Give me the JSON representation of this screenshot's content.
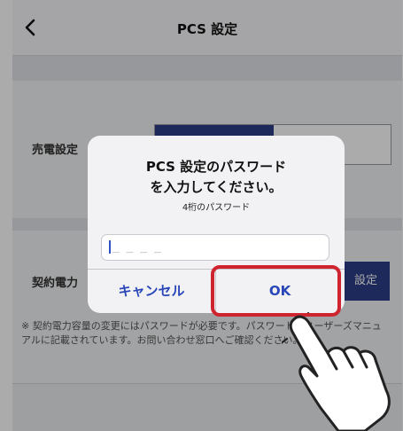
{
  "navbar": {
    "title": "PCS 設定",
    "back_icon": "chevron-left-icon"
  },
  "settings": {
    "sell_label": "売電設定",
    "contract_label": "契約電力",
    "contract_button": "設定",
    "note": "※ 契約電力容量の変更にはパスワードが必要です。パスワードはユーザーズマニュアルに記載されています。お問い合わせ窓口へご確認ください。"
  },
  "dialog": {
    "title_line1": "PCS 設定のパスワード",
    "title_line2": "を入力してください。",
    "subtitle": "4桁のパスワード",
    "input_placeholder": "_ _ _ _",
    "cancel_label": "キャンセル",
    "ok_label": "OK"
  },
  "colors": {
    "accent": "#2a3e86",
    "dialog_button_text": "#2946b8",
    "highlight_border": "#cf2430"
  }
}
